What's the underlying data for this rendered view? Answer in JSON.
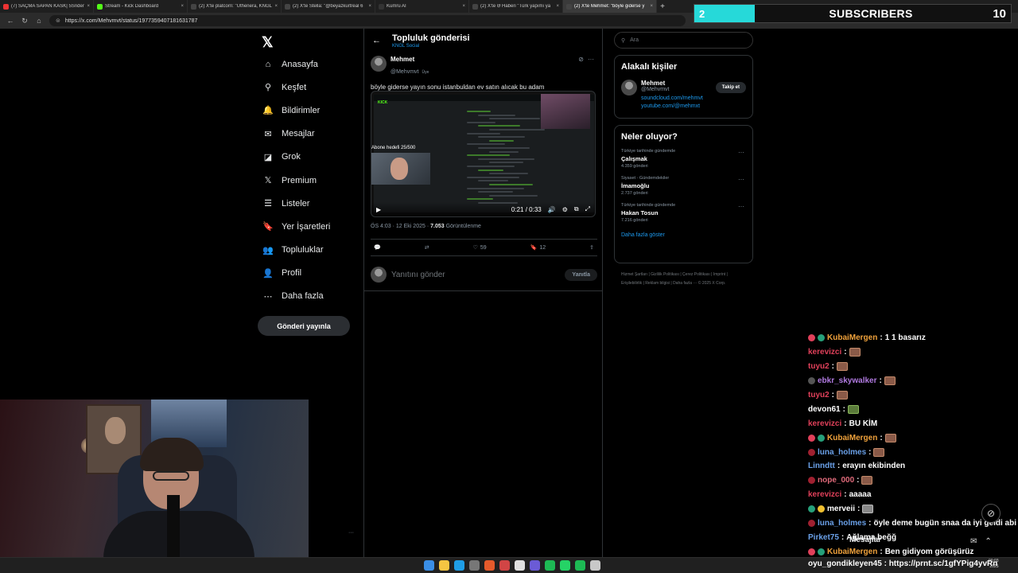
{
  "browser": {
    "tabs": [
      {
        "title": "(7) SAÇMA SAPAN KASK| 5Srider",
        "favicon_color": "#e33"
      },
      {
        "title": "Stream - Kick Dashboard",
        "favicon_color": "#53fc18"
      },
      {
        "title": "(2) X'te platcorn: \"Uthenera, KNGL",
        "favicon_color": "#444"
      },
      {
        "title": "(2) X'te Stella: \"@beyazkurtreal 6",
        "favicon_color": "#444"
      },
      {
        "title": "Kumru AI",
        "favicon_color": "#333"
      },
      {
        "title": "(2) X'te Ə Haberi \"Türk yapımı ya",
        "favicon_color": "#444"
      },
      {
        "title": "(2) X'te Mehmet: \"böyle giderse y",
        "favicon_color": "#444",
        "active": true
      }
    ],
    "url": "https://x.com/Mehvmvt/status/1977359407181631787"
  },
  "overlay": {
    "sub_count": "2",
    "sub_label": "SUBSCRIBERS",
    "sub_goal": "10",
    "sub_progress": 0.2
  },
  "nav": {
    "items": [
      {
        "label": "Anasayfa",
        "icon": "home-icon",
        "glyph": "⌂"
      },
      {
        "label": "Keşfet",
        "icon": "search-icon",
        "glyph": "⚲"
      },
      {
        "label": "Bildirimler",
        "icon": "bell-icon",
        "glyph": "🔔"
      },
      {
        "label": "Mesajlar",
        "icon": "mail-icon",
        "glyph": "✉"
      },
      {
        "label": "Grok",
        "icon": "grok-icon",
        "glyph": "◪"
      },
      {
        "label": "Premium",
        "icon": "x-premium-icon",
        "glyph": "𝕏"
      },
      {
        "label": "Listeler",
        "icon": "list-icon",
        "glyph": "☰"
      },
      {
        "label": "Yer İşaretleri",
        "icon": "bookmark-icon",
        "glyph": "🔖"
      },
      {
        "label": "Topluluklar",
        "icon": "communities-icon",
        "glyph": "👥"
      },
      {
        "label": "Profil",
        "icon": "profile-icon",
        "glyph": "👤"
      },
      {
        "label": "Daha fazla",
        "icon": "more-circle-icon",
        "glyph": "⋯"
      }
    ],
    "post_button": "Gönderi yayınla"
  },
  "main": {
    "header_title": "Topluluk gönderisi",
    "header_sub": "KNGL Social",
    "post": {
      "author": "Mehmet",
      "handle": "@Mehvmvt",
      "member_badge": "Üye",
      "text": "böyle giderse yayın sonu istanbuldan ev satın alıcak bu adam",
      "video_goal_text": "Abone hedefi 25/500",
      "video_time": "0:21 / 0:33",
      "time": "ÖS 4:03 · 12 Eki 2025 · ",
      "views": "7.053",
      "views_label": "Görüntülenme",
      "likes": "59",
      "bookmarks": "12"
    },
    "reply_placeholder": "Yanıtını gönder",
    "reply_button": "Yanıtla"
  },
  "right": {
    "search_placeholder": "Ara",
    "related_title": "Alakalı kişiler",
    "related_user": {
      "name": "Mehmet",
      "handle": "@Mehvmvt",
      "link1": "soundcloud.com/mehmvt",
      "link2": "youtube.com/@mehmxt",
      "follow": "Takip et"
    },
    "trends_title": "Neler oluyor?",
    "trends": [
      {
        "category": "Türkiye tarihinde gündemde",
        "name": "Çalışmak",
        "count": "4.359 gönderi"
      },
      {
        "category": "Siyaset · Gündemdekiler",
        "name": "İmamoğlu",
        "count": "2.737 gönderi"
      },
      {
        "category": "Türkiye tarihinde gündemde",
        "name": "Hakan Tosun",
        "count": "7.216 gönderi"
      }
    ],
    "show_more": "Daha fazla göster",
    "footer": "Hizmet Şartları  |  Gizlilik Politikası  |  Çerez Politikası  |  Imprint  |  Erişilebilirlik  |  Reklam bilgisi  |  Daha fazla ···  © 2025 X Corp."
  },
  "chat": [
    {
      "user": "KubaiMergen",
      "color": "#f0a23c",
      "msg": "1 1 basarız",
      "badges": [
        "#e0405a",
        "#26a07a"
      ]
    },
    {
      "user": "kerevizci",
      "color": "#e0405a",
      "msg": "",
      "emote": "brown"
    },
    {
      "user": "tuyu2",
      "color": "#e0405a",
      "msg": "",
      "emote": "brown"
    },
    {
      "user": "ebkr_skywalker",
      "color": "#b07ae0",
      "msg": "",
      "emote": "brown",
      "badges": [
        "#555"
      ]
    },
    {
      "user": "tuyu2",
      "color": "#e0405a",
      "msg": "",
      "emote": "brown"
    },
    {
      "user": "devon61",
      "color": "#ffffff",
      "msg": "",
      "emote": "green"
    },
    {
      "user": "kerevizci",
      "color": "#e0405a",
      "msg": "BU KİM"
    },
    {
      "user": "KubaiMergen",
      "color": "#f0a23c",
      "msg": "",
      "emote": "brown",
      "badges": [
        "#e0405a",
        "#26a07a"
      ]
    },
    {
      "user": "luna_holmes",
      "color": "#6aa0e8",
      "msg": "",
      "emote": "brown",
      "badges": [
        "#a02030"
      ]
    },
    {
      "user": "Linndtt",
      "color": "#6aa0e8",
      "msg": "erayın ekibinden"
    },
    {
      "user": "nope_000",
      "color": "#e06a7a",
      "msg": "",
      "emote": "brown",
      "badges": [
        "#a02030"
      ]
    },
    {
      "user": "kerevizci",
      "color": "#e0405a",
      "msg": "aaaaa"
    },
    {
      "user": "merveii",
      "color": "#ffffff",
      "msg": "",
      "emote": "gray",
      "badges": [
        "#26a07a",
        "#f0c030"
      ]
    },
    {
      "user": "luna_holmes",
      "color": "#6aa0e8",
      "msg": "öyle deme bugün snaa da iyi geldi abi",
      "badges": [
        "#a02030"
      ]
    },
    {
      "user": "Pirket75",
      "color": "#6aa0e8",
      "msg": "Ağlama beğğ"
    },
    {
      "user": "KubaiMergen",
      "color": "#f0a23c",
      "msg": "Ben gidiyom görüşürüz",
      "badges": [
        "#e0405a",
        "#26a07a"
      ]
    }
  ],
  "drawer": {
    "label": "Mesajlar"
  },
  "taskbar": {
    "chat_line": "oyu_gondikleyen45 : https://prnt.sc/1gfYPig4yvRn",
    "time": "00:03",
    "date": "2025",
    "icons": [
      "#3a8ee6",
      "#f5c542",
      "#1f9ee6",
      "#777",
      "#e55a2b",
      "#d14545",
      "#e0e0e0",
      "#6b5bd6",
      "#1db954",
      "#25d366",
      "#1db954",
      "#c8c8c8"
    ]
  }
}
